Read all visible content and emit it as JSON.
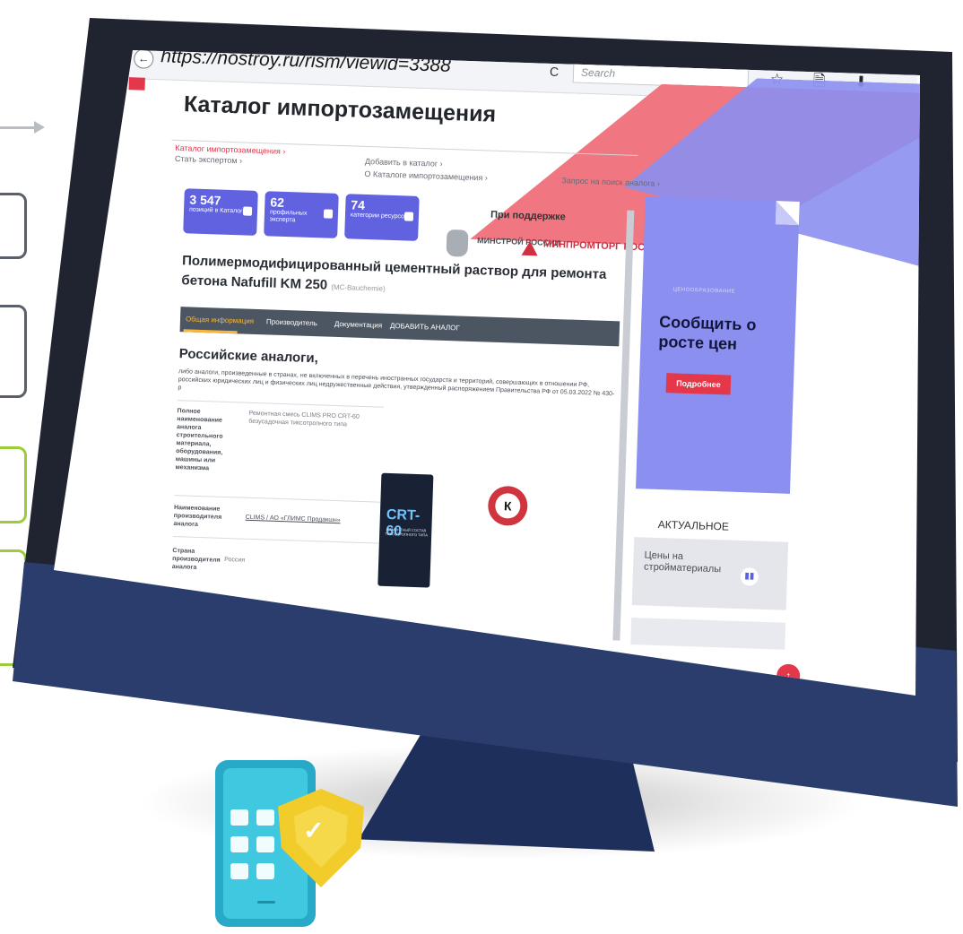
{
  "browser": {
    "url": "https://nostroy.ru/rism/viewid=3388",
    "search_placeholder": "Search",
    "back_glyph": "←",
    "reload_glyph": "C",
    "toolbar_icons": "☆ 🗎 ⬇ ⌂ ≡"
  },
  "header": {
    "title": "Каталог импортозамещения",
    "nav": {
      "catalog": "Каталог импортозамещения ›",
      "expert": "Стать экспертом ›",
      "add": "Добавить в каталог ›",
      "about": "О Каталоге импортозамещения ›",
      "analog_request": "Запрос на поиск аналога ›"
    }
  },
  "stats": [
    {
      "number": "3 547",
      "label": "позиций в Каталоге"
    },
    {
      "number": "62",
      "label": "профильных эксперта"
    },
    {
      "number": "74",
      "label": "категории ресурсов"
    }
  ],
  "support": {
    "label": "При поддержке",
    "minstroy": "МИНСТРОЙ РОССИИ",
    "minpromtorg": "МИНПРОМТОРГ РОССИИ"
  },
  "product": {
    "title": "Полимермодифицированный цементный раствор для ремонта бетона Nafufill KM 250",
    "brand": "(MC-Bauchemie)"
  },
  "tabs": {
    "general": "Общая информация",
    "manufacturer": "Производитель",
    "docs": "Документация",
    "add_analog": "ДОБАВИТЬ АНАЛОГ"
  },
  "analogs": {
    "title": "Российские аналоги,",
    "description": "либо аналоги, произведенные в странах, не включенных в перечень иностранных государств и территорий, совершающих в отношении РФ, российских юридических лиц и физических лиц недружественные действия, утвержденный распоряжением Правительства РФ от 05.03.2022 № 430-р",
    "rows": [
      {
        "label": "Полное наименование аналога строительного материала, оборудования, машины или механизма",
        "value": "Ремонтная смесь CLIMS PRO CRT-60 безусадочная тиксотропного типа"
      },
      {
        "label": "Наименование производителя аналога",
        "value": "CLIMS / АО «ГЛИМС Продакшн»"
      },
      {
        "label": "Страна производителя аналога",
        "value": "Россия"
      }
    ],
    "product_code": "CRT-60",
    "product_sub": "РЕМОНТНЫЙ СОСТАВ ТИКСОТРОПНОГО ТИПА",
    "logo_letter": "К"
  },
  "sidebar": {
    "banner_small": "ЦЕНООБРАЗОВАНИЕ",
    "banner_big": "Сообщить о росте цен",
    "banner_button": "Подробнее",
    "dots": "○ ○ ○ ● ○",
    "actual_title": "АКТУАЛЬНОЕ",
    "news_text": "Цены на стройматериалы"
  },
  "colors": {
    "accent_red": "#e4374a",
    "accent_blue": "#6062e0",
    "banner_purple": "#8b8ff0",
    "monitor": "#2a3d6d"
  }
}
